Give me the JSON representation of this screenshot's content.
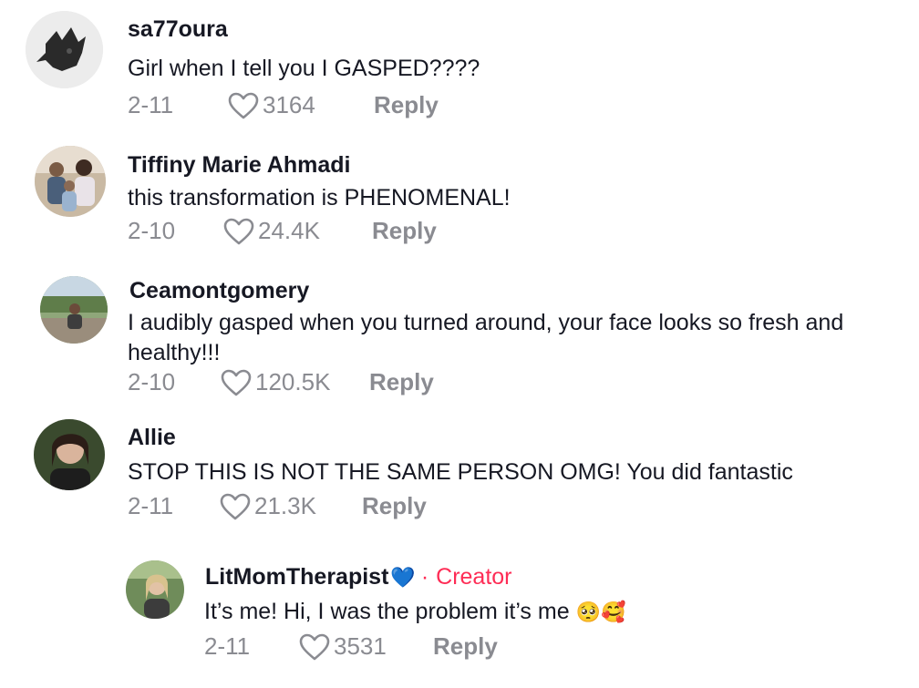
{
  "comments": [
    {
      "username": "sa77oura",
      "text": "Girl when I tell you I GASPED????",
      "date": "2-11",
      "likes": "3164",
      "reply_label": "Reply"
    },
    {
      "username": "Tiffiny Marie Ahmadi",
      "text": "this transformation is PHENOMENAL!",
      "date": "2-10",
      "likes": "24.4K",
      "reply_label": "Reply"
    },
    {
      "username": "Ceamontgomery",
      "text_line1": "I audibly gasped when you turned around, your face looks so fresh and",
      "text_line2": "healthy!!!",
      "date": "2-10",
      "likes": "120.5K",
      "reply_label": "Reply"
    },
    {
      "username": "Allie",
      "text": "STOP THIS IS NOT THE SAME PERSON OMG! You did fantastic",
      "date": "2-11",
      "likes": "21.3K",
      "reply_label": "Reply"
    }
  ],
  "reply": {
    "username": "LitMomTherapist",
    "username_emoji": "💙",
    "separator": "·",
    "badge": "Creator",
    "text": "It’s me! Hi, I was the problem it’s me",
    "text_emoji": "🥺🥰",
    "date": "2-11",
    "likes": "3531",
    "reply_label": "Reply"
  },
  "icons": {
    "like": "heart-outline-icon"
  },
  "colors": {
    "text": "#161823",
    "meta": "#8a8b91",
    "creator": "#fe2c55",
    "verified_heart": "#2f80ed"
  }
}
